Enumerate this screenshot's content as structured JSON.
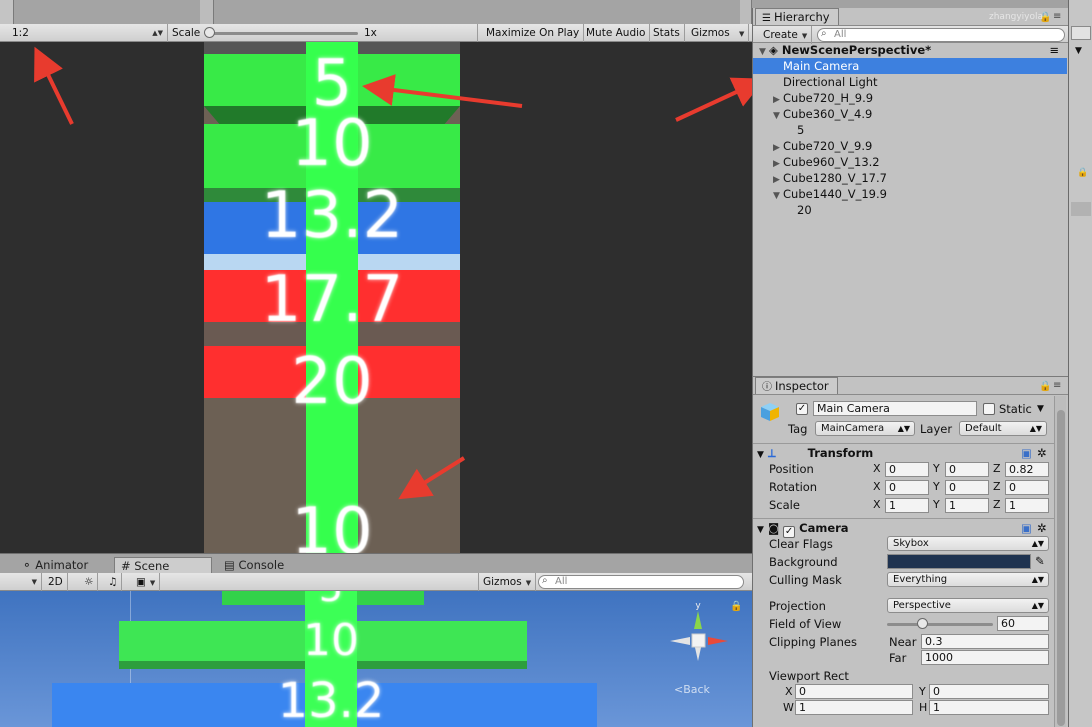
{
  "game": {
    "aspect": "1:2",
    "scale_label": "Scale",
    "scale_value": "1x",
    "scale_level": 0.0,
    "maximize": "Maximize On Play",
    "mute": "Mute Audio",
    "stats": "Stats",
    "gizmos": "Gizmos",
    "labels": [
      "5",
      "10",
      "13.2",
      "17.7",
      "20",
      "10"
    ]
  },
  "dock": {
    "tabs": [
      "Animator",
      "Scene",
      "Console"
    ],
    "active": "Scene",
    "mode_2d": "2D",
    "gizmos": "Gizmos",
    "search_placeholder": "All",
    "back": "Back",
    "labels": [
      "5",
      "10",
      "13.2"
    ],
    "gizmo_axis": "y"
  },
  "hierarchy": {
    "tab": "Hierarchy",
    "create": "Create",
    "search_placeholder": "All",
    "watermark": "zhangyiyola",
    "scene": "NewScenePerspective*",
    "items": [
      "Main Camera",
      "Directional Light",
      "Cube720_H_9.9",
      "Cube360_V_4.9",
      "5",
      "Cube720_V_9.9",
      "Cube960_V_13.2",
      "Cube1280_V_17.7",
      "Cube1440_V_19.9",
      "20"
    ]
  },
  "inspector": {
    "tab": "Inspector",
    "name": "Main Camera",
    "static": "Static",
    "tag_label": "Tag",
    "tag": "MainCamera",
    "layer_label": "Layer",
    "layer": "Default",
    "transform": {
      "title": "Transform",
      "position_label": "Position",
      "position": [
        "0",
        "0",
        "0.82"
      ],
      "rotation_label": "Rotation",
      "rotation": [
        "0",
        "0",
        "0"
      ],
      "scale_label": "Scale",
      "scale": [
        "1",
        "1",
        "1"
      ]
    },
    "camera": {
      "title": "Camera",
      "clear_flags_label": "Clear Flags",
      "clear_flags": "Skybox",
      "background_label": "Background",
      "background_color": "#1f3350",
      "culling_label": "Culling Mask",
      "culling": "Everything",
      "projection_label": "Projection",
      "projection": "Perspective",
      "fov_label": "Field of View",
      "fov": "60",
      "fov_level": 0.33,
      "clip_label": "Clipping Planes",
      "near_label": "Near",
      "near": "0.3",
      "far_label": "Far",
      "far": "1000",
      "viewport_label": "Viewport Rect",
      "vp_x": "0",
      "vp_y": "0",
      "vp_w": "1",
      "vp_h": "1"
    },
    "axis": [
      "X",
      "Y",
      "Z"
    ],
    "vp_axis": [
      "X",
      "Y",
      "W",
      "H"
    ]
  },
  "colors": {
    "selection": "#3d80df",
    "green": "#35ff4d",
    "blue": "#3077e6",
    "red": "#ff3232",
    "annotation": "#e83b2e"
  }
}
